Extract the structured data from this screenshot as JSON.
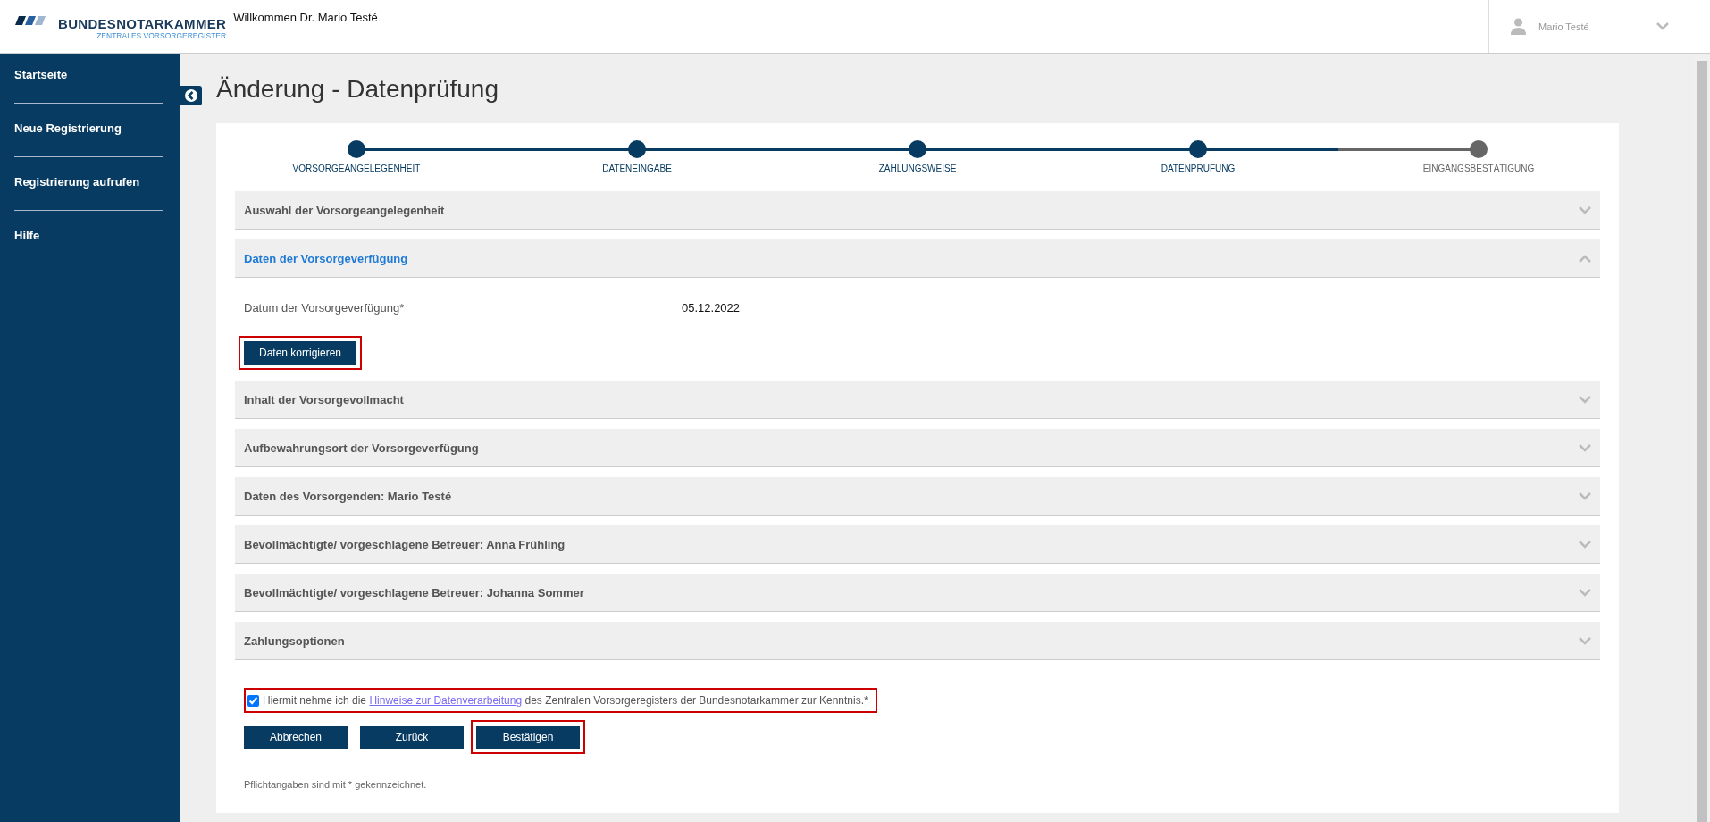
{
  "header": {
    "logo_title": "BUNDESNOTARKAMMER",
    "logo_subtitle": "ZENTRALES VORSORGEREGISTER",
    "welcome": "Willkommen Dr. Mario Testé",
    "user_name": "Mario Testé"
  },
  "sidebar": {
    "items": [
      {
        "label": "Startseite"
      },
      {
        "label": "Neue Registrierung"
      },
      {
        "label": "Registrierung aufrufen"
      },
      {
        "label": "Hilfe"
      }
    ]
  },
  "page_title": "Änderung - Datenprüfung",
  "stepper": [
    {
      "label": "VORSORGEANGELEGENHEIT",
      "completed": true
    },
    {
      "label": "DATENEINGABE",
      "completed": true
    },
    {
      "label": "ZAHLUNGSWEISE",
      "completed": true
    },
    {
      "label": "DATENPRÜFUNG",
      "completed": true
    },
    {
      "label": "EINGANGSBESTÄTIGUNG",
      "completed": false
    }
  ],
  "sections": [
    {
      "title": "Auswahl der Vorsorgeangelegenheit",
      "expanded": false
    },
    {
      "title": "Daten der Vorsorgeverfügung",
      "expanded": true,
      "fields": [
        {
          "label": "Datum der Vorsorgeverfügung*",
          "value": "05.12.2022"
        }
      ],
      "button": {
        "label": "Daten korrigieren",
        "highlighted": true
      }
    },
    {
      "title": "Inhalt der Vorsorgevollmacht",
      "expanded": false
    },
    {
      "title": "Aufbewahrungsort der Vorsorgeverfügung",
      "expanded": false
    },
    {
      "title": "Daten des Vorsorgenden: Mario Testé",
      "expanded": false
    },
    {
      "title": "Bevollmächtigte/ vorgeschlagene Betreuer: Anna Frühling",
      "expanded": false
    },
    {
      "title": "Bevollmächtigte/ vorgeschlagene Betreuer: Johanna Sommer",
      "expanded": false
    },
    {
      "title": "Zahlungsoptionen",
      "expanded": false
    }
  ],
  "consent": {
    "checked": true,
    "highlighted": true,
    "text_before": "Hiermit nehme ich die",
    "link": "Hinweise zur Datenverarbeitung",
    "text_after": "des Zentralen Vorsorgeregisters der Bundesnotarkammer zur Kenntnis.*"
  },
  "buttons": [
    {
      "label": "Abbrechen",
      "highlighted": false
    },
    {
      "label": "Zurück",
      "highlighted": false
    },
    {
      "label": "Bestätigen",
      "highlighted": true
    }
  ],
  "footnote": "Pflichtangaben sind mit * gekennzeichnet."
}
